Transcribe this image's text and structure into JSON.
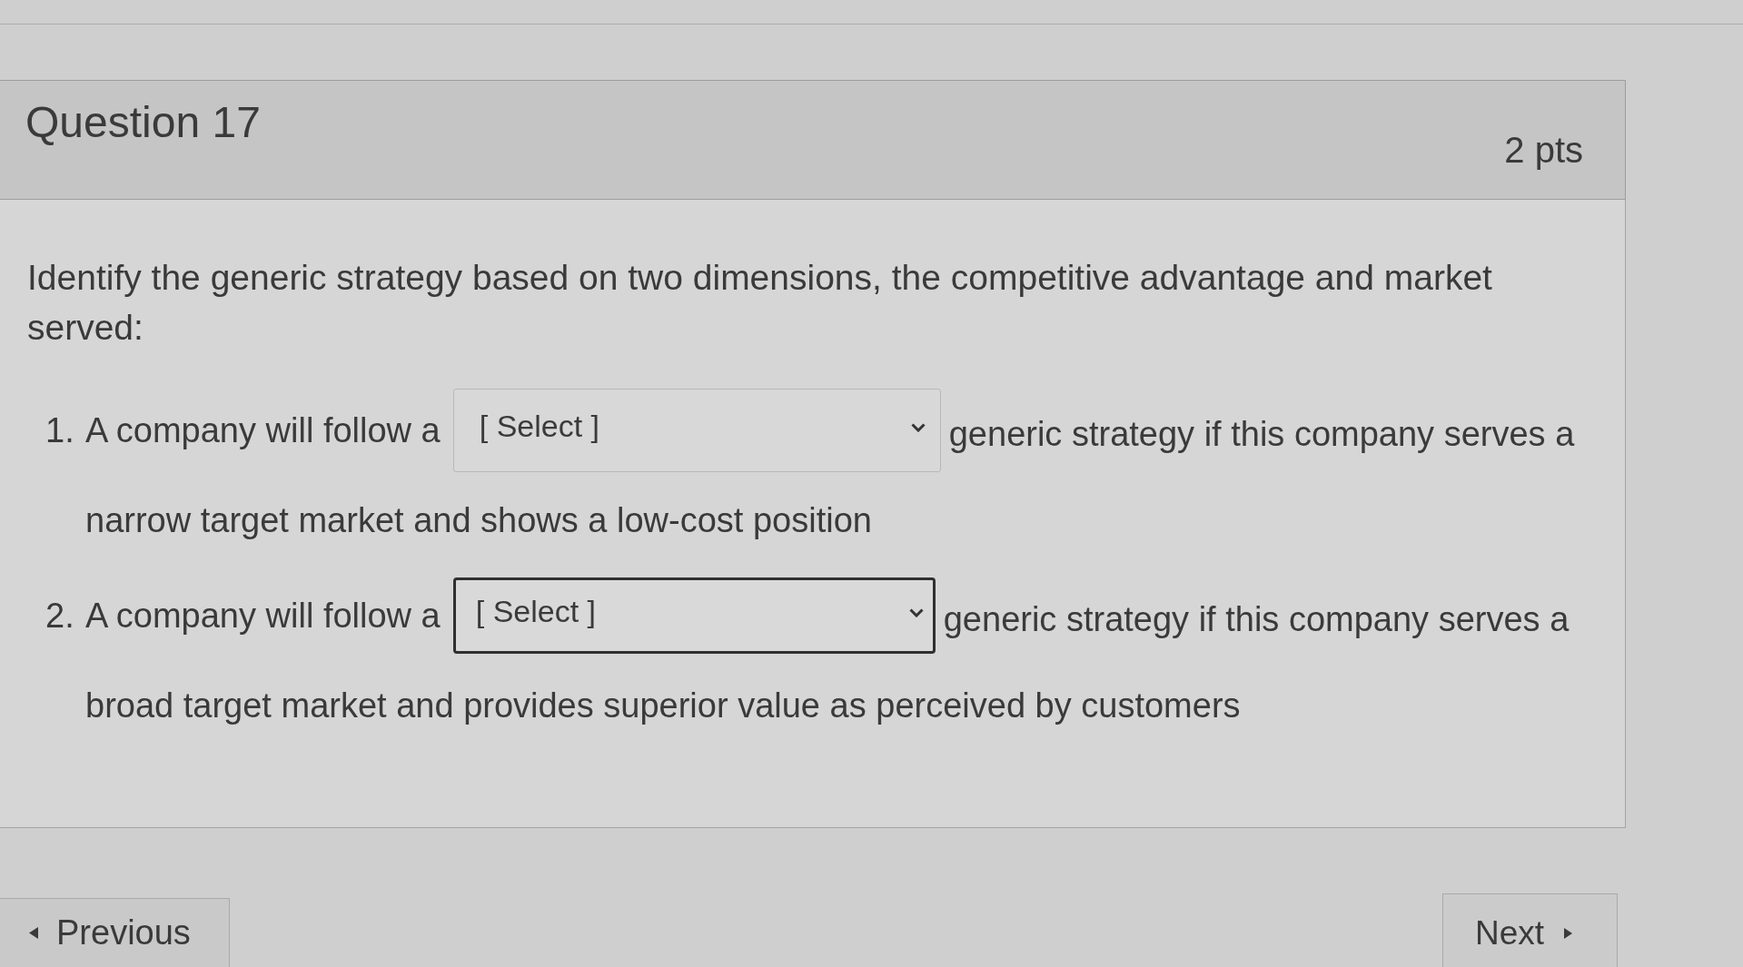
{
  "question": {
    "title": "Question 17",
    "points": "2 pts"
  },
  "prompt": "Identify the generic strategy based on two dimensions, the competitive advantage and market served:",
  "items": [
    {
      "number": "1.",
      "text_before": "A company will follow a",
      "dropdown": {
        "value": "[ Select ]",
        "focused": false
      },
      "text_after": "generic strategy if this company serves a",
      "text_continued": "narrow target market and shows a low-cost position"
    },
    {
      "number": "2.",
      "text_before": "A company will follow a",
      "dropdown": {
        "value": "[ Select ]",
        "focused": true
      },
      "text_after": "generic strategy if this company serves a",
      "text_continued": "broad target market and provides superior value as perceived by customers"
    }
  ],
  "navigation": {
    "previous": "Previous",
    "next": "Next"
  }
}
